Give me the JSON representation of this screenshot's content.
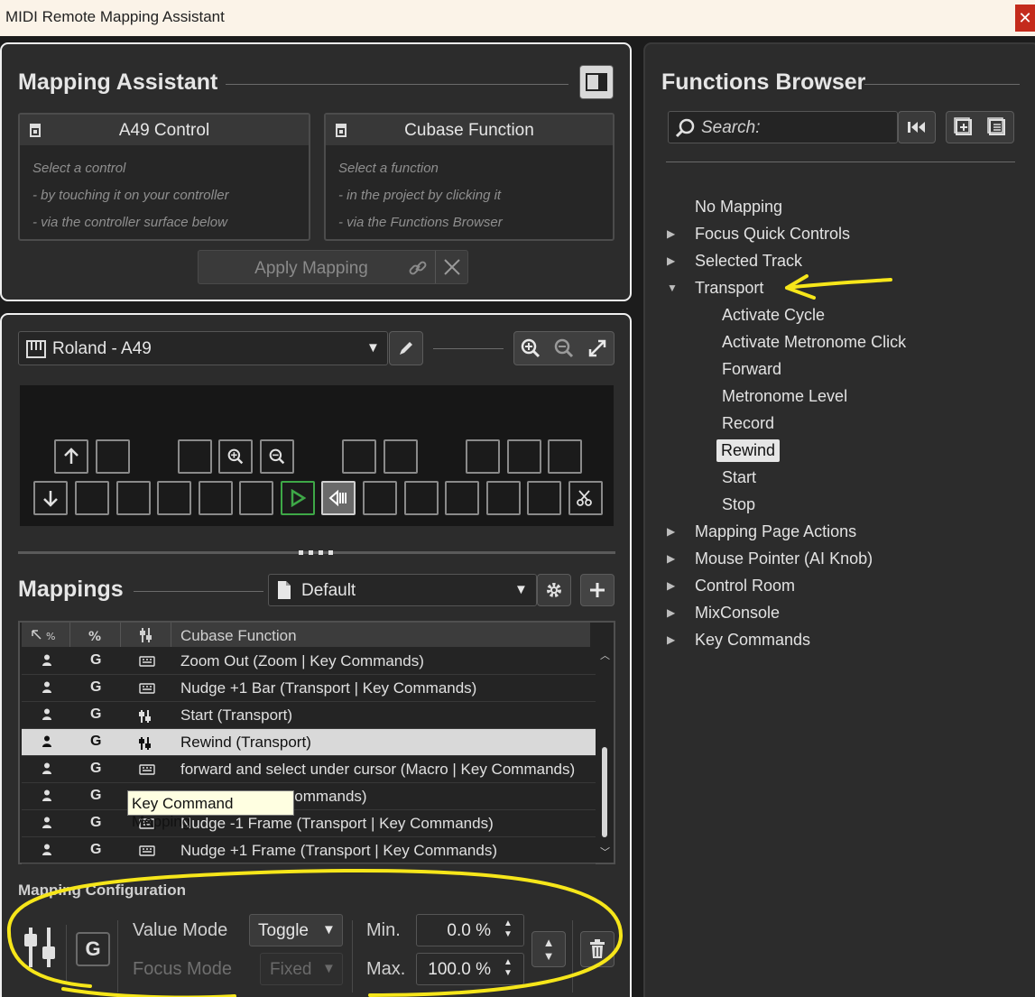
{
  "window": {
    "title": "MIDI Remote Mapping Assistant",
    "close_glyph": "✕"
  },
  "mapping_assistant": {
    "title": "Mapping Assistant",
    "control_card": {
      "title": "A49 Control",
      "hints": [
        "Select a control",
        "- by touching it on your controller",
        "- via the controller surface below"
      ]
    },
    "function_card": {
      "title": "Cubase Function",
      "hints": [
        "Select a function",
        "- in the project by clicking it",
        "- via the Functions Browser"
      ]
    },
    "apply_label": "Apply Mapping"
  },
  "controller": {
    "selected": "Roland - A49"
  },
  "mappings": {
    "title": "Mappings",
    "page": "Default",
    "column_header": "Cubase Function",
    "rows": [
      {
        "g": "G",
        "type": "keyboard",
        "function": "Zoom Out (Zoom | Key Commands)",
        "selected": false
      },
      {
        "g": "G",
        "type": "keyboard",
        "function": "Nudge +1 Bar (Transport | Key Commands)",
        "selected": false
      },
      {
        "g": "G",
        "type": "fader",
        "function": "Start (Transport)",
        "selected": false
      },
      {
        "g": "G",
        "type": "fader",
        "function": "Rewind (Transport)",
        "selected": true
      },
      {
        "g": "G",
        "type": "keyboard",
        "function": "forward and select under cursor (Macro | Key Commands)",
        "selected": false
      },
      {
        "g": "G",
        "type": "keyboard",
        "function": "Cut (Edit | Key Commands)",
        "selected": false
      },
      {
        "g": "G",
        "type": "keyboard",
        "function": "Nudge -1 Frame (Transport | Key Commands)",
        "selected": false
      },
      {
        "g": "G",
        "type": "keyboard",
        "function": "Nudge +1 Frame (Transport | Key Commands)",
        "selected": false
      }
    ],
    "tooltip": "Key Command Mapping"
  },
  "config": {
    "title": "Mapping Configuration",
    "g_label": "G",
    "value_mode_label": "Value Mode",
    "value_mode": "Toggle",
    "focus_mode_label": "Focus Mode",
    "focus_mode": "Fixed",
    "min_label": "Min.",
    "min_value": "0.0 %",
    "max_label": "Max.",
    "max_value": "100.0 %"
  },
  "functions_browser": {
    "title": "Functions Browser",
    "search_placeholder": "Search:",
    "tree": [
      {
        "label": "No Mapping",
        "level": 0,
        "arrow": ""
      },
      {
        "label": "Focus Quick Controls",
        "level": 0,
        "arrow": "▶"
      },
      {
        "label": "Selected Track",
        "level": 0,
        "arrow": "▶"
      },
      {
        "label": "Transport",
        "level": 0,
        "arrow": "▼"
      },
      {
        "label": "Activate Cycle",
        "level": 1,
        "arrow": ""
      },
      {
        "label": "Activate Metronome Click",
        "level": 1,
        "arrow": ""
      },
      {
        "label": "Forward",
        "level": 1,
        "arrow": ""
      },
      {
        "label": "Metronome Level",
        "level": 1,
        "arrow": ""
      },
      {
        "label": "Record",
        "level": 1,
        "arrow": ""
      },
      {
        "label": "Rewind",
        "level": 1,
        "arrow": "",
        "highlighted": true
      },
      {
        "label": "Start",
        "level": 1,
        "arrow": ""
      },
      {
        "label": "Stop",
        "level": 1,
        "arrow": ""
      },
      {
        "label": "Mapping Page Actions",
        "level": 0,
        "arrow": "▶"
      },
      {
        "label": "Mouse Pointer (AI Knob)",
        "level": 0,
        "arrow": "▶"
      },
      {
        "label": "Control Room",
        "level": 0,
        "arrow": "▶"
      },
      {
        "label": "MixConsole",
        "level": 0,
        "arrow": "▶"
      },
      {
        "label": "Key Commands",
        "level": 0,
        "arrow": "▶"
      }
    ]
  },
  "colors": {
    "annotation": "#f6e61a",
    "accent_play": "#3ea847",
    "background": "#2c2c2c"
  }
}
